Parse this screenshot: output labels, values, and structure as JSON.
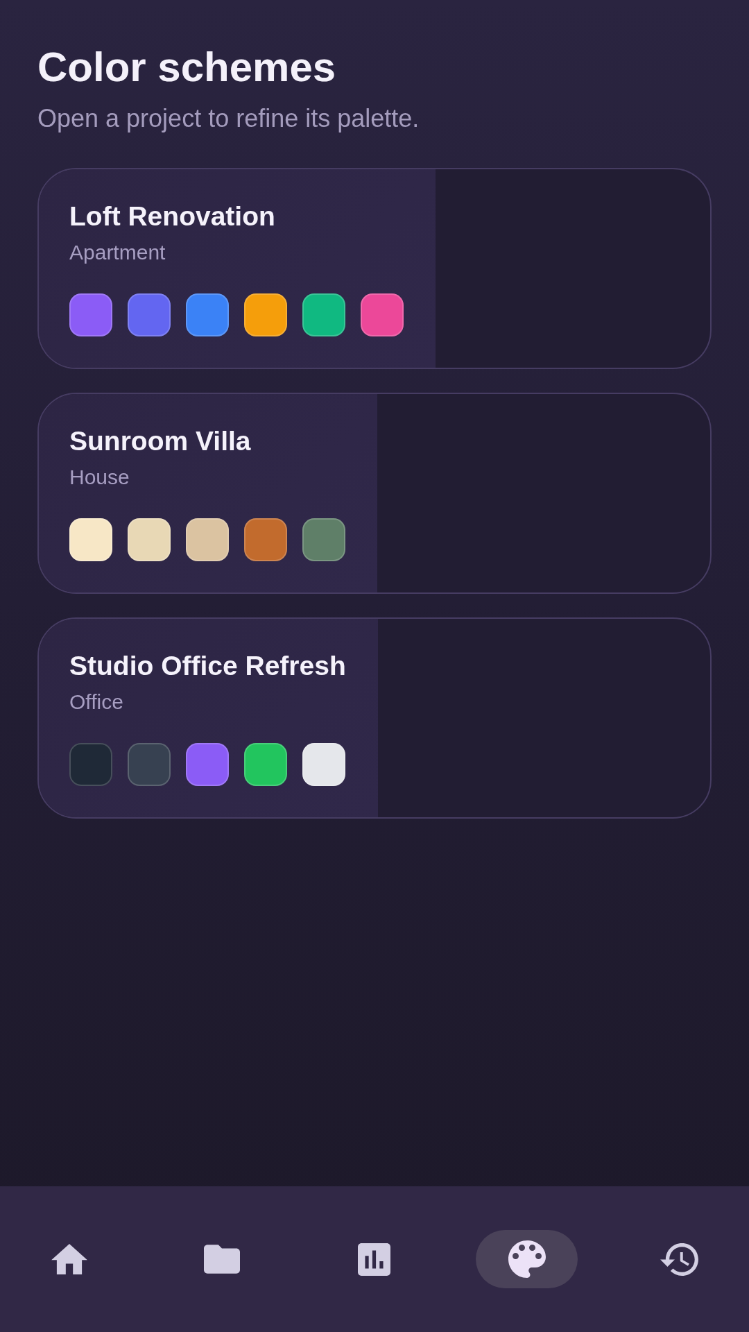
{
  "header": {
    "title": "Color schemes",
    "subtitle": "Open a project to refine its palette."
  },
  "projects": [
    {
      "name": "Loft Renovation",
      "type": "Apartment",
      "swatches": [
        {
          "color": "#8b5cf6"
        },
        {
          "color": "#6366f1"
        },
        {
          "color": "#3b82f6"
        },
        {
          "color": "#f59e0b"
        },
        {
          "color": "#10b981"
        },
        {
          "color": "#ec4899"
        }
      ]
    },
    {
      "name": "Sunroom Villa",
      "type": "House",
      "swatches": [
        {
          "color": "#f7e7c6"
        },
        {
          "color": "#e8d8b5"
        },
        {
          "color": "#dbc3a1"
        },
        {
          "color": "#c26b2d"
        },
        {
          "color": "#5f7f68"
        }
      ]
    },
    {
      "name": "Studio Office Refresh",
      "type": "Office",
      "swatches": [
        {
          "color": "#1f2937"
        },
        {
          "color": "#374151"
        },
        {
          "color": "#8b5cf6"
        },
        {
          "color": "#22c55e"
        },
        {
          "color": "#e5e7eb"
        }
      ]
    }
  ],
  "bottom_nav": {
    "items": [
      {
        "selected": false
      },
      {
        "selected": false
      },
      {
        "selected": false
      },
      {
        "selected": true
      },
      {
        "selected": false
      }
    ]
  }
}
